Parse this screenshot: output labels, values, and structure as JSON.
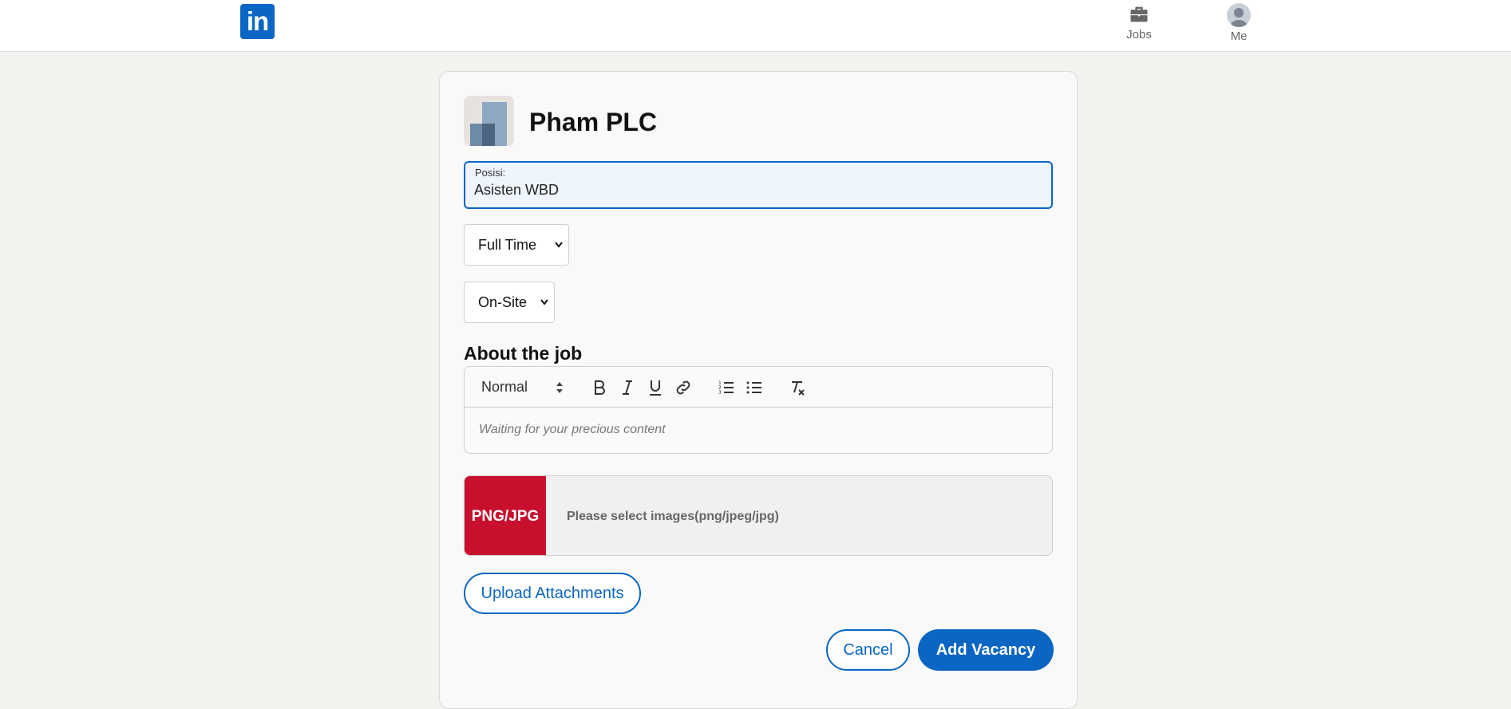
{
  "header": {
    "logo_text": "in",
    "nav": [
      {
        "label": "Jobs",
        "icon": "briefcase-icon"
      },
      {
        "label": "Me",
        "icon": "avatar-icon"
      }
    ]
  },
  "company": {
    "name": "Pham PLC"
  },
  "form": {
    "position_label": "Posisi:",
    "position_value": "Asisten WBD",
    "employment_type": "Full Time",
    "workplace_type": "On-Site",
    "about_title": "About the job",
    "editor": {
      "format": "Normal",
      "placeholder": "Waiting for your precious content"
    },
    "upload": {
      "badge": "PNG/JPG",
      "hint": "Please select images(png/jpeg/jpg)"
    },
    "upload_button": "Upload Attachments",
    "cancel_button": "Cancel",
    "submit_button": "Add Vacancy"
  },
  "colors": {
    "brand": "#0a66c2",
    "badge": "#c8102e",
    "background": "#f3f2ef"
  }
}
